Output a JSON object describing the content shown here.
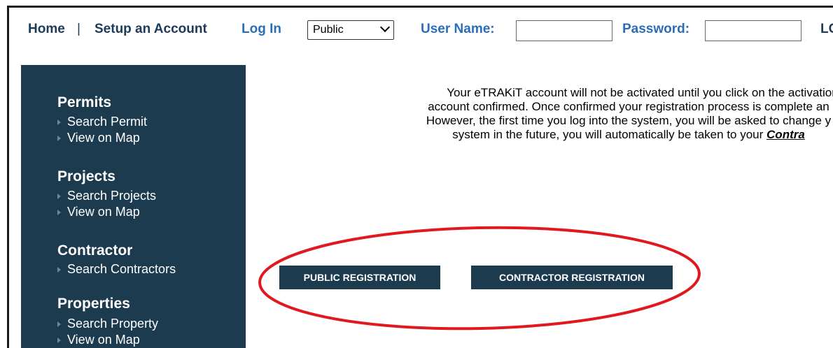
{
  "header": {
    "home": "Home",
    "sep": "|",
    "setup": "Setup an Account",
    "login": "Log In",
    "login_type": {
      "selected": "Public"
    },
    "username_label": "User Name:",
    "username_value": "",
    "password_label": "Password:",
    "password_value": "",
    "cutoff": "LC"
  },
  "sidebar": {
    "sections": [
      {
        "title": "Permits",
        "items": [
          "Search Permit",
          "View on Map"
        ]
      },
      {
        "title": "Projects",
        "items": [
          "Search Projects",
          "View on Map"
        ]
      },
      {
        "title": "Contractor",
        "items": [
          "Search Contractors"
        ]
      },
      {
        "title": "Properties",
        "items": [
          "Search Property",
          "View on Map"
        ]
      }
    ]
  },
  "message": {
    "line1": "Your eTRAKiT account will not be activated until you click on the activation",
    "line2": "account confirmed. Once confirmed your registration process is complete an",
    "line3": "However, the first time you log into the system, you will be asked to change y",
    "line4": "system in the future, you will automatically be taken to your",
    "line4_emphasis": "Contra"
  },
  "buttons": {
    "public": "PUBLIC REGISTRATION",
    "contractor": "CONTRACTOR REGISTRATION"
  },
  "colors": {
    "sidebar_bg": "#1c3b4f",
    "link_blue": "#2a6ebb",
    "nav_dark": "#1c3b5a",
    "highlight_red": "#e0191f"
  }
}
